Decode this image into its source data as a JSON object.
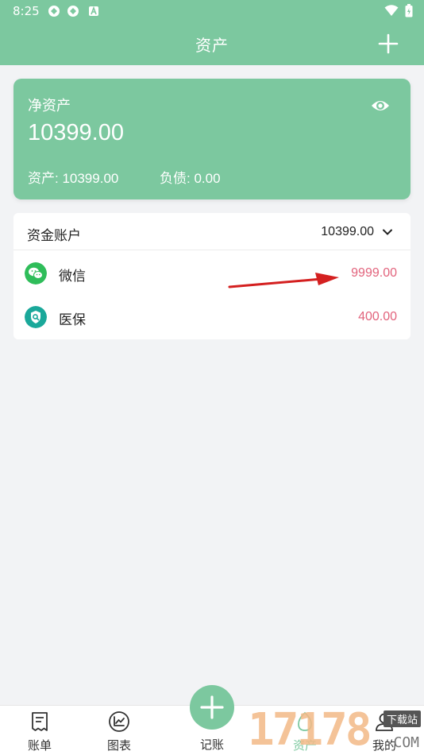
{
  "status_bar": {
    "time": "8:25"
  },
  "app_bar": {
    "title": "资产"
  },
  "net_asset_card": {
    "label": "净资产",
    "amount": "10399.00",
    "assets_text": "资产: 10399.00",
    "debts_text": "负债: 0.00"
  },
  "accounts": {
    "header_label": "资金账户",
    "header_total": "10399.00",
    "items": [
      {
        "name": "微信",
        "value": "9999.00",
        "icon": "wechat-icon",
        "color": "#2fbd5a"
      },
      {
        "name": "医保",
        "value": "400.00",
        "icon": "medical-insurance-icon",
        "color": "#1aa89a"
      }
    ]
  },
  "tabs": [
    {
      "label": "账单",
      "icon": "bill-icon"
    },
    {
      "label": "图表",
      "icon": "chart-icon"
    },
    {
      "label": "记账",
      "icon": "plus-icon"
    },
    {
      "label": "资产",
      "icon": "asset-icon"
    },
    {
      "label": "我的",
      "icon": "user-icon"
    }
  ],
  "watermark": {
    "number": "17178",
    "tag": "下载站",
    "suffix": "COM"
  },
  "colors": {
    "primary": "#7cc89f",
    "amount_red": "#e2637c",
    "background": "#f2f3f5"
  }
}
